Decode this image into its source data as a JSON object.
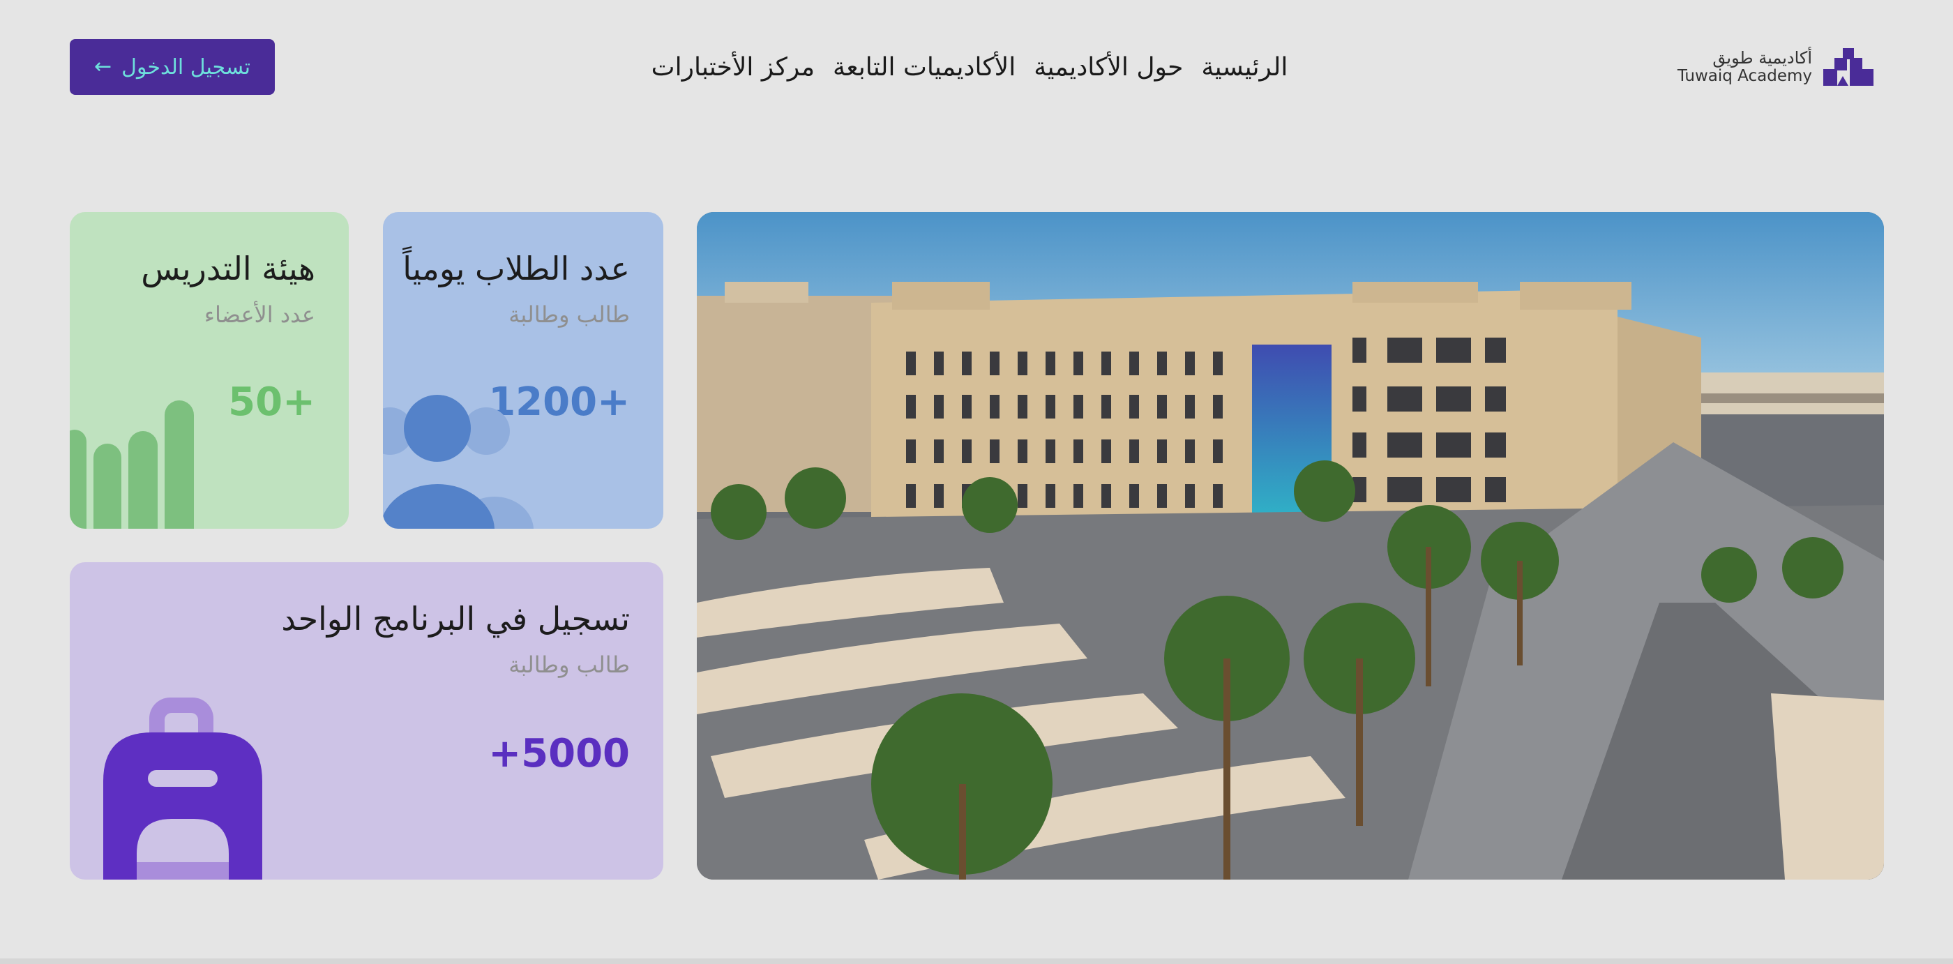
{
  "header": {
    "login_label": "تسجيل الدخول",
    "login_arrow": "←",
    "nav": [
      {
        "label": "الرئيسية"
      },
      {
        "label": "حول الأكاديمية"
      },
      {
        "label": "الأكاديميات التابعة"
      },
      {
        "label": "مركز الأختبارات"
      }
    ],
    "logo_ar": "أكاديمية طويق",
    "logo_en": "Tuwaiq Academy"
  },
  "stats": {
    "faculty": {
      "title": "هيئة التدريس",
      "subtitle": "عدد الأعضاء",
      "value": "50+"
    },
    "students": {
      "title": "عدد الطلاب يومياً",
      "subtitle": "طالب وطالبة",
      "value": "1200+"
    },
    "enrollment": {
      "title": "تسجيل في البرنامج الواحد",
      "subtitle": "طالب وطالبة",
      "value": "+5000"
    }
  },
  "colors": {
    "brand": "#4a2c98",
    "login_text": "#6ee0dc",
    "faculty_bg": "#bfe2bf",
    "students_bg": "#a9c1e6",
    "enroll_bg": "#cdc3e6"
  },
  "icons": [
    "arrow-left-icon",
    "tuwaiq-logo-icon",
    "bar-chart-icon",
    "people-icon",
    "backpack-icon"
  ]
}
